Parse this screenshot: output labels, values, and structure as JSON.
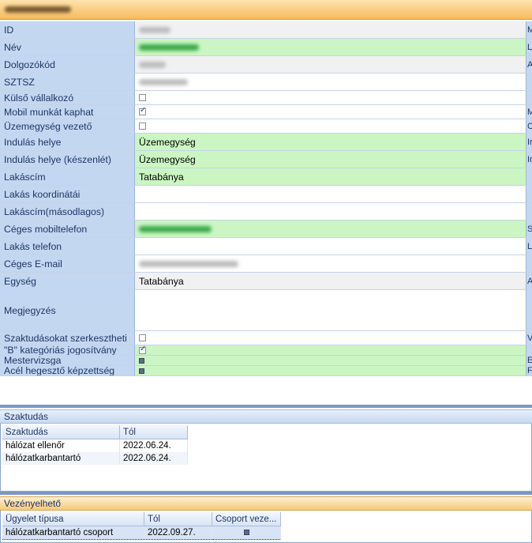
{
  "window": {
    "title": ""
  },
  "fields": [
    {
      "label": "ID",
      "value": "",
      "bg": "gray",
      "kind": "blurred",
      "edge": "M"
    },
    {
      "label": "Név",
      "value": "",
      "bg": "green",
      "kind": "blurred-green",
      "edge": "L"
    },
    {
      "label": "Dolgozókód",
      "value": "",
      "bg": "gray",
      "kind": "blurred",
      "edge": "A"
    },
    {
      "label": "SZTSZ",
      "value": "",
      "bg": "white",
      "kind": "blurred",
      "edge": ""
    },
    {
      "label": "Külső vállalkozó",
      "value": "",
      "bg": "white",
      "kind": "checkbox",
      "checked": false,
      "edge": ""
    },
    {
      "label": "Mobil munkát kaphat",
      "value": "",
      "bg": "white",
      "kind": "checkbox",
      "checked": true,
      "edge": "M"
    },
    {
      "label": "Üzemegység vezető",
      "value": "",
      "bg": "white",
      "kind": "checkbox",
      "checked": false,
      "edge": "C"
    },
    {
      "label": "Indulás helye",
      "value": "Üzemegység",
      "bg": "green",
      "kind": "text",
      "edge": "Ir"
    },
    {
      "label": "Indulás helye (készenlét)",
      "value": "Üzemegység",
      "bg": "green",
      "kind": "text",
      "edge": "Ir"
    },
    {
      "label": "Lakáscím",
      "value": "Tatabánya",
      "bg": "green",
      "kind": "text",
      "edge": ""
    },
    {
      "label": "Lakás koordinátái",
      "value": "",
      "bg": "white",
      "kind": "text",
      "edge": ""
    },
    {
      "label": "Lakáscím(másodlagos)",
      "value": "",
      "bg": "white",
      "kind": "text",
      "edge": ""
    },
    {
      "label": "Céges mobiltelefon",
      "value": "",
      "bg": "green",
      "kind": "blurred-green",
      "edge": "S"
    },
    {
      "label": "Lakás telefon",
      "value": "",
      "bg": "white",
      "kind": "text",
      "edge": "L"
    },
    {
      "label": "Céges E-mail",
      "value": "",
      "bg": "white",
      "kind": "blurred",
      "edge": ""
    },
    {
      "label": "Egység",
      "value": "Tatabánya",
      "bg": "gray",
      "kind": "text",
      "edge": "A"
    },
    {
      "label": "Megjegyzés",
      "value": "",
      "bg": "white",
      "kind": "text",
      "edge": ""
    },
    {
      "label": "Szaktudásokat szerkesztheti",
      "value": "",
      "bg": "white",
      "kind": "checkbox",
      "checked": false,
      "edge": "V"
    },
    {
      "label": "\"B\" kategóriás jogosítvány",
      "value": "",
      "bg": "green",
      "kind": "checkbox",
      "checked": true,
      "edge": ""
    },
    {
      "label": "Mestervizsga",
      "value": "",
      "bg": "green",
      "kind": "square",
      "edge": "E"
    },
    {
      "label": "Acél hegesztő képzettség",
      "value": "",
      "bg": "green",
      "kind": "square",
      "edge": "F"
    }
  ],
  "skills": {
    "title": "Szaktudás",
    "columns": [
      "Szaktudás",
      "Tól"
    ],
    "rows": [
      [
        "hálózat ellenőr",
        "2022.06.24."
      ],
      [
        "hálózatkarbantartó",
        "2022.06.24."
      ]
    ]
  },
  "dispatch": {
    "title": "Vezényelhető",
    "columns": [
      "Ügyelet típusa",
      "Tól",
      "Csoport veze..."
    ],
    "rows": [
      [
        "hálózatkarbantartó csoport",
        "2022.09.27.",
        ""
      ]
    ]
  },
  "colors": {
    "label_bg": "#c4d7f1",
    "green_field": "#cbf6c3",
    "title_orange": "#f8bb5c",
    "separator": "#7b98c4"
  }
}
